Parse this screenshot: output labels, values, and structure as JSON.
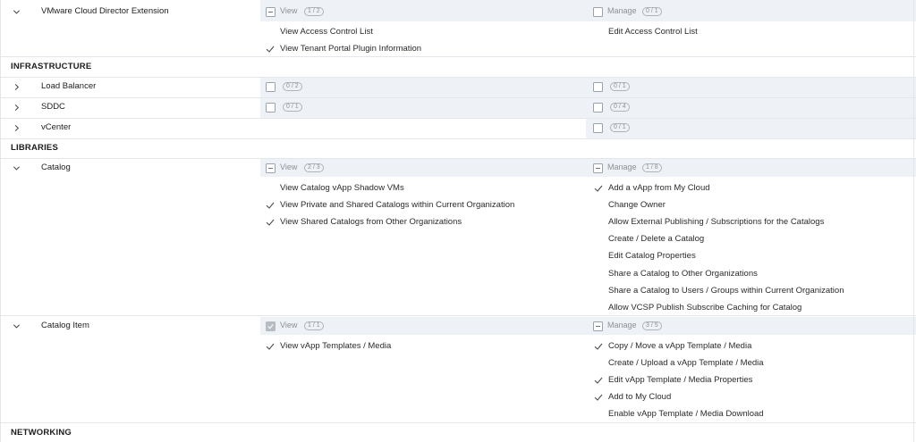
{
  "rows": {
    "vmware": {
      "name": "VMware Cloud Director Extension",
      "view_label": "View",
      "view_badge": "1 / 2",
      "manage_label": "Manage",
      "manage_badge": "0 / 1",
      "view_items": [
        {
          "label": "View Access Control List",
          "checked": false
        },
        {
          "label": "View Tenant Portal Plugin Information",
          "checked": true
        }
      ],
      "manage_items": [
        {
          "label": "Edit Access Control List",
          "checked": false
        }
      ]
    },
    "load_balancer": {
      "name": "Load Balancer",
      "view_badge": "0 / 2",
      "manage_badge": "0 / 1"
    },
    "sddc": {
      "name": "SDDC",
      "view_badge": "0 / 1",
      "manage_badge": "0 / 4"
    },
    "vcenter": {
      "name": "vCenter",
      "manage_badge": "0 / 1"
    },
    "catalog": {
      "name": "Catalog",
      "view_label": "View",
      "view_badge": "2 / 3",
      "manage_label": "Manage",
      "manage_badge": "1 / 8",
      "view_items": [
        {
          "label": "View Catalog vApp Shadow VMs",
          "checked": false
        },
        {
          "label": "View Private and Shared Catalogs within Current Organization",
          "checked": true
        },
        {
          "label": "View Shared Catalogs from Other Organizations",
          "checked": true
        }
      ],
      "manage_items": [
        {
          "label": "Add a vApp from My Cloud",
          "checked": true
        },
        {
          "label": "Change Owner",
          "checked": false
        },
        {
          "label": "Allow External Publishing / Subscriptions for the Catalogs",
          "checked": false
        },
        {
          "label": "Create / Delete a Catalog",
          "checked": false
        },
        {
          "label": "Edit Catalog Properties",
          "checked": false
        },
        {
          "label": "Share a Catalog to Other Organizations",
          "checked": false
        },
        {
          "label": "Share a Catalog to Users / Groups within Current Organization",
          "checked": false
        },
        {
          "label": "Allow VCSP Publish Subscribe Caching for Catalog",
          "checked": false
        }
      ]
    },
    "catalog_item": {
      "name": "Catalog Item",
      "view_label": "View",
      "view_badge": "1 / 1",
      "manage_label": "Manage",
      "manage_badge": "3 / 5",
      "view_items": [
        {
          "label": "View vApp Templates / Media",
          "checked": true
        }
      ],
      "manage_items": [
        {
          "label": "Copy / Move a vApp Template / Media",
          "checked": true
        },
        {
          "label": "Create / Upload a vApp Template / Media",
          "checked": false
        },
        {
          "label": "Edit vApp Template / Media Properties",
          "checked": true
        },
        {
          "label": "Add to My Cloud",
          "checked": true
        },
        {
          "label": "Enable vApp Template / Media Download",
          "checked": false
        }
      ]
    }
  },
  "sections": {
    "infrastructure": "INFRASTRUCTURE",
    "libraries": "LIBRARIES",
    "networking": "NETWORKING"
  },
  "colors": {
    "header_band": "#eef2f6",
    "divider": "#e3e6ea",
    "muted_text": "#8b9198"
  }
}
